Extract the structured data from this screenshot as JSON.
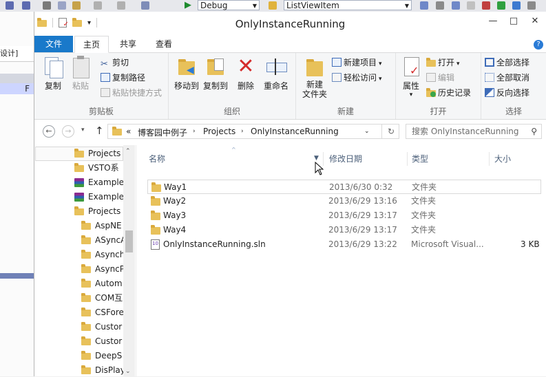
{
  "vs": {
    "config_combo": "Debug",
    "item_combo": "ListViewItem",
    "side_tab_label": "设计]",
    "side_band_label": "F"
  },
  "window": {
    "title": "OnlyInstanceRunning"
  },
  "ribbon_tabs": {
    "file": "文件",
    "home": "主页",
    "share": "共享",
    "view": "查看"
  },
  "ribbon": {
    "clipboard": {
      "label": "剪贴板",
      "copy": "复制",
      "paste": "粘贴",
      "cut": "剪切",
      "copy_path": "复制路径",
      "paste_shortcut": "粘贴快捷方式"
    },
    "organize": {
      "label": "组织",
      "move_to": "移动到",
      "copy_to": "复制到",
      "delete": "删除",
      "rename": "重命名"
    },
    "new": {
      "label": "新建",
      "new_folder": "新建\n文件夹",
      "new_item": "新建项目",
      "easy_access": "轻松访问"
    },
    "open": {
      "label": "打开",
      "properties": "属性",
      "open": "打开",
      "edit": "编辑",
      "history": "历史记录"
    },
    "select": {
      "label": "选择",
      "select_all": "全部选择",
      "select_none": "全部取消",
      "invert": "反向选择"
    }
  },
  "address": {
    "overflow": "«",
    "crumbs": [
      "博客园中例子",
      "Projects",
      "OnlyInstanceRunning"
    ],
    "search_placeholder": "搜索 OnlyInstanceRunning"
  },
  "nav_items": [
    {
      "label": "Projects",
      "icon": "folder-icon"
    },
    {
      "label": "VSTO系",
      "icon": "folder-icon"
    },
    {
      "label": "Example",
      "icon": "rar-archive-icon"
    },
    {
      "label": "Example",
      "icon": "rar-archive-icon"
    },
    {
      "label": "Projects",
      "icon": "folder-icon"
    },
    {
      "label": "AspNE",
      "icon": "folder-icon"
    },
    {
      "label": "ASyncA",
      "icon": "folder-icon"
    },
    {
      "label": "Asynch",
      "icon": "folder-icon"
    },
    {
      "label": "AsyncP",
      "icon": "folder-icon"
    },
    {
      "label": "Autom",
      "icon": "folder-icon"
    },
    {
      "label": "COM互",
      "icon": "folder-icon"
    },
    {
      "label": "CSFore",
      "icon": "folder-icon"
    },
    {
      "label": "Custor",
      "icon": "folder-icon"
    },
    {
      "label": "Custor",
      "icon": "folder-icon"
    },
    {
      "label": "DeepS",
      "icon": "folder-icon"
    },
    {
      "label": "DisPlay",
      "icon": "folder-icon"
    }
  ],
  "columns": {
    "name": "名称",
    "date": "修改日期",
    "type": "类型",
    "size": "大小"
  },
  "files": [
    {
      "name": "Way1",
      "date": "2013/6/30 0:32",
      "type": "文件夹",
      "size": "",
      "icon": "folder-icon"
    },
    {
      "name": "Way2",
      "date": "2013/6/29 13:16",
      "type": "文件夹",
      "size": "",
      "icon": "folder-icon"
    },
    {
      "name": "Way3",
      "date": "2013/6/29 13:17",
      "type": "文件夹",
      "size": "",
      "icon": "folder-icon"
    },
    {
      "name": "Way4",
      "date": "2013/6/29 13:17",
      "type": "文件夹",
      "size": "",
      "icon": "folder-icon"
    },
    {
      "name": "OnlyInstanceRunning.sln",
      "date": "2013/6/29 13:22",
      "type": "Microsoft Visual...",
      "size": "3 KB",
      "icon": "sln-file-icon"
    }
  ]
}
